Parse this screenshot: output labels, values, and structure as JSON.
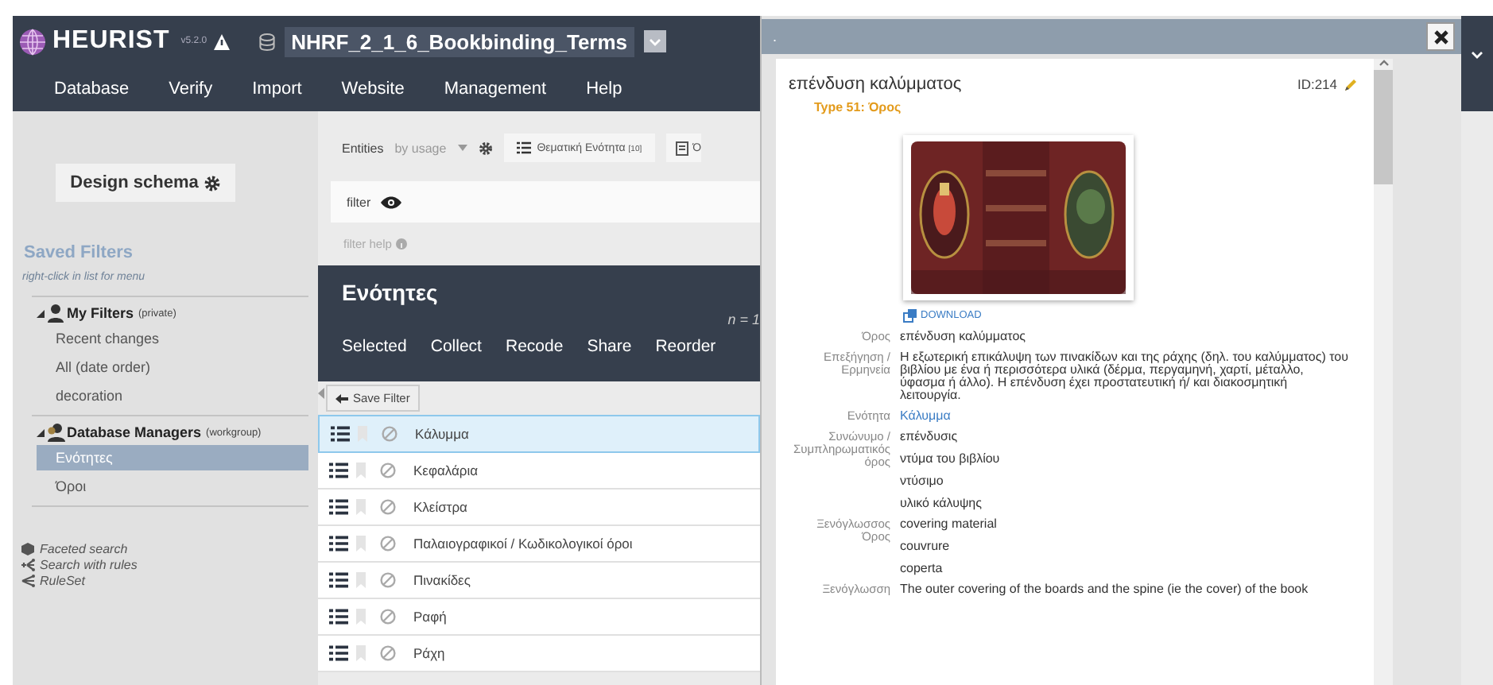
{
  "header": {
    "logo": "HEURIST",
    "version": "v5.2.0",
    "database": "NHRF_2_1_6_Bookbinding_Terms",
    "menu": [
      "Database",
      "Verify",
      "Import",
      "Website",
      "Management",
      "Help"
    ]
  },
  "sidebar": {
    "design_button": "Design schema",
    "title": "Saved Filters",
    "hint": "right-click in list for menu",
    "groups": [
      {
        "title": "My Filters",
        "scope": "(private)",
        "expanded": true,
        "items": [
          {
            "label": "Recent changes",
            "selected": false
          },
          {
            "label": "All (date order)",
            "selected": false
          },
          {
            "label": "decoration",
            "selected": false
          }
        ]
      },
      {
        "title": "Database Managers",
        "scope": "(workgroup)",
        "expanded": true,
        "items": [
          {
            "label": "Ενότητες",
            "selected": true
          },
          {
            "label": "Όροι",
            "selected": false
          }
        ]
      }
    ],
    "links": [
      {
        "label": "Faceted search",
        "kind": "faceted"
      },
      {
        "label": "Search with rules",
        "kind": "rules"
      },
      {
        "label": "RuleSet",
        "kind": "ruleset"
      }
    ]
  },
  "toolbar": {
    "entities_label": "Entities",
    "sort": "by usage",
    "entity_button": {
      "label": "Θεματική Ενότητα",
      "count": "[10]"
    },
    "next_button": "Ό"
  },
  "filter": {
    "label": "filter",
    "help": "filter help"
  },
  "results": {
    "title": "Ενότητες",
    "count": "n = 1",
    "actions": [
      "Selected",
      "Collect",
      "Recode",
      "Share",
      "Reorder"
    ],
    "save_filter": "Save Filter",
    "rows": [
      {
        "title": "Κάλυμμα",
        "selected": true
      },
      {
        "title": "Κεφαλάρια",
        "selected": false
      },
      {
        "title": "Κλείστρα",
        "selected": false
      },
      {
        "title": "Παλαιογραφικοί / Κωδικολογικοί όροι",
        "selected": false
      },
      {
        "title": "Πινακίδες",
        "selected": false
      },
      {
        "title": "Ραφή",
        "selected": false
      },
      {
        "title": "Ράχη",
        "selected": false
      }
    ]
  },
  "record_dialog": {
    "title": ".",
    "record_title": "επένδυση καλύμματος",
    "id": "ID:214",
    "type": "Type 51: Όρος",
    "download": "DOWNLOAD",
    "fields": [
      {
        "label": "Όρος",
        "values": [
          {
            "text": "επένδυση καλύμματος",
            "kind": "text"
          }
        ]
      },
      {
        "label": "Επεξήγηση / Ερμηνεία",
        "values": [
          {
            "text": "Η εξωτερική επικάλυψη των πινακίδων και της ράχης (δηλ. του καλύμματος) του βιβλίου με ένα ή περισσότερα υλικά (δέρμα, περγαμηνή, χαρτί, μέταλλο, ύφασμα ή άλλο). Η επένδυση έχει προστατευτική ή/ και διακοσμητική λειτουργία.",
            "kind": "text"
          }
        ]
      },
      {
        "label": "Ενότητα",
        "values": [
          {
            "text": "Κάλυμμα",
            "kind": "link"
          }
        ]
      },
      {
        "label": "Συνώνυμο / Συμπληρωματικός όρος",
        "values": [
          {
            "text": "επένδυσις",
            "kind": "text"
          },
          {
            "text": "ντύμα του βιβλίου",
            "kind": "text"
          },
          {
            "text": "ντύσιμο",
            "kind": "text"
          },
          {
            "text": "υλικό κάλυψης",
            "kind": "text"
          }
        ]
      },
      {
        "label": "Ξενόγλωσσος Όρος",
        "values": [
          {
            "text": "covering material",
            "kind": "text"
          },
          {
            "text": "couvrure",
            "kind": "text"
          },
          {
            "text": "coperta",
            "kind": "text"
          }
        ]
      },
      {
        "label": "Ξενόγλωσση",
        "values": [
          {
            "text": "The outer covering of the boards and the spine (ie the cover) of the book",
            "kind": "text"
          }
        ]
      }
    ]
  }
}
